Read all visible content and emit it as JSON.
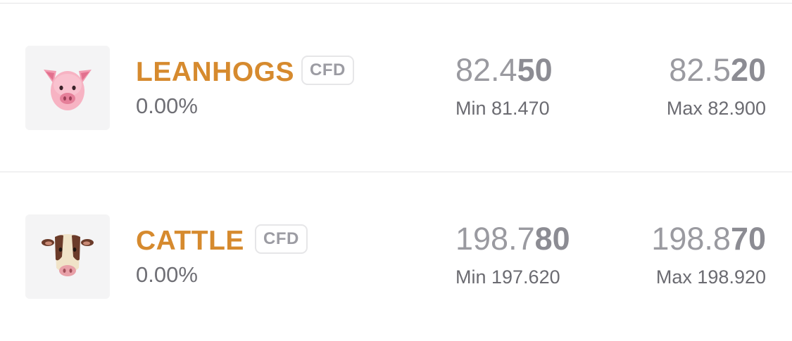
{
  "instruments": [
    {
      "name": "LEANHOGS",
      "badge": "CFD",
      "change": "0.00%",
      "icon": "pig-face-icon",
      "bid": {
        "main": "82.4",
        "emph": "50"
      },
      "ask": {
        "main": "82.5",
        "emph": "20"
      },
      "min": "Min 81.470",
      "max": "Max 82.900"
    },
    {
      "name": "CATTLE",
      "badge": "CFD",
      "change": "0.00%",
      "icon": "cow-face-icon",
      "bid": {
        "main": "198.7",
        "emph": "80"
      },
      "ask": {
        "main": "198.8",
        "emph": "70"
      },
      "min": "Min 197.620",
      "max": "Max 198.920"
    }
  ],
  "colors": {
    "name": "#d68a2e",
    "price": "#9a9aa0",
    "text": "#6f6f75",
    "divider": "#e4e4e6"
  }
}
